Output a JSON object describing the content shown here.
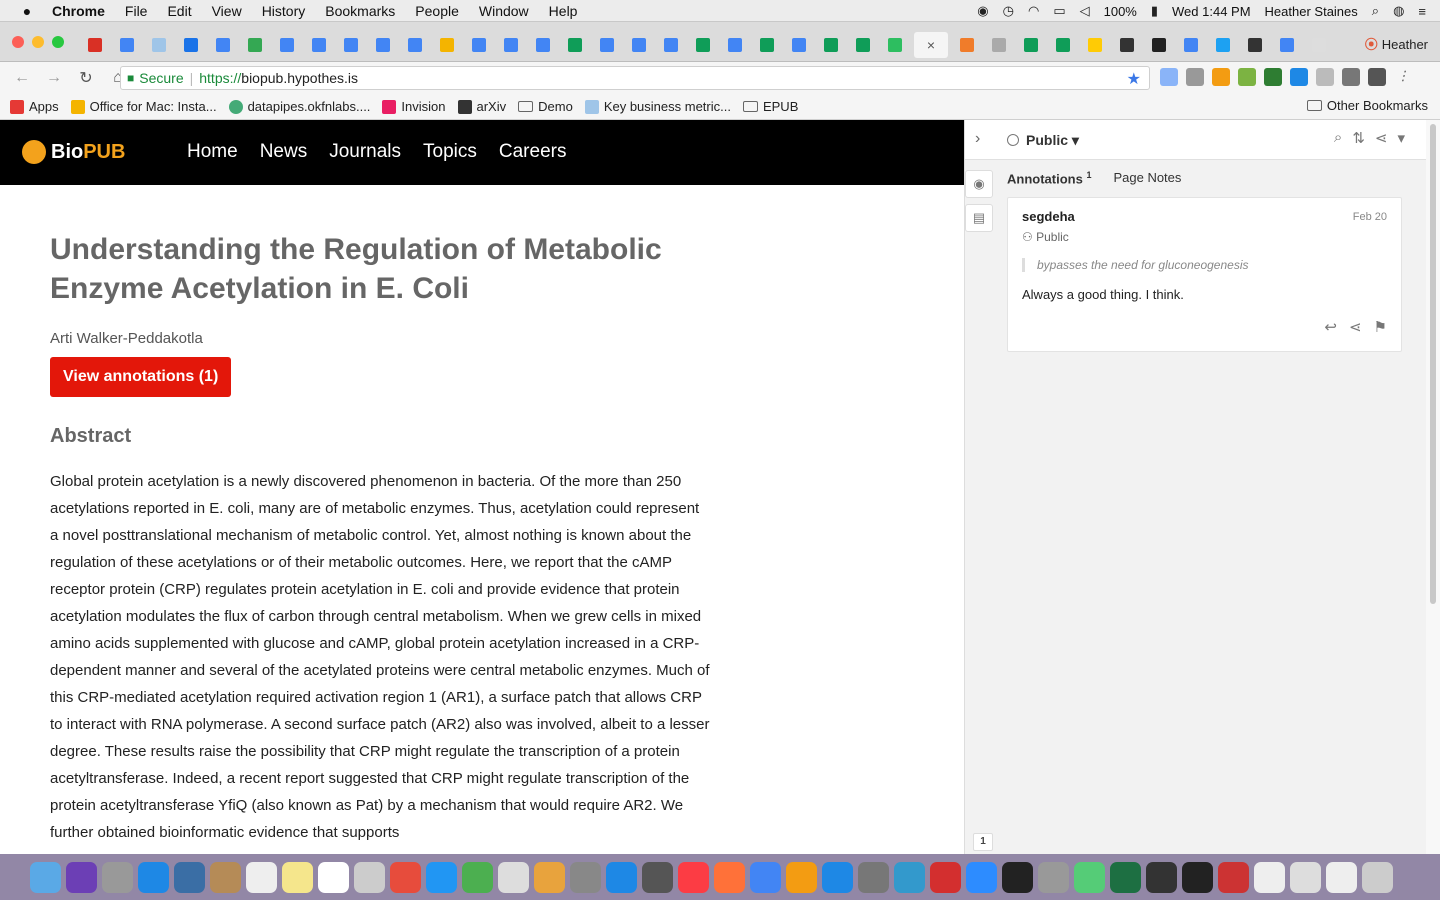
{
  "menubar": {
    "app": "Chrome",
    "items": [
      "File",
      "Edit",
      "View",
      "History",
      "Bookmarks",
      "People",
      "Window",
      "Help"
    ],
    "battery": "100%",
    "clock": "Wed 1:44 PM",
    "user": "Heather Staines"
  },
  "tabstrip": {
    "profile_name": "Heather",
    "close_glyph": "×",
    "tab_icons": [
      "gmail",
      "docs",
      "photos",
      "calendar",
      "docs",
      "drive",
      "docs",
      "docs",
      "docs",
      "docs",
      "docs",
      "slides",
      "docs",
      "docs",
      "docs",
      "sheets",
      "docs",
      "docs",
      "docs",
      "sheets",
      "docs",
      "sheets",
      "docs",
      "sheets",
      "sheets",
      "evernote",
      "active",
      "w3schools",
      "file",
      "sheets",
      "sheets",
      "michigan",
      "hypothesis",
      "hypothesis-h",
      "docs",
      "twitter",
      "hypothesis",
      "docs",
      "new-tab"
    ]
  },
  "addressbar": {
    "secure_label": "Secure",
    "url_scheme": "https://",
    "url_host": "biopub.hypothes.is"
  },
  "bookmarks": {
    "items": [
      "Apps",
      "Office for Mac: Insta...",
      "datapipes.okfnlabs....",
      "Invision",
      "arXiv",
      "Demo",
      "Key business metric...",
      "EPUB"
    ],
    "other": "Other Bookmarks"
  },
  "site": {
    "logo_bio": "Bio",
    "logo_pub": "PUB",
    "nav": [
      "Home",
      "News",
      "Journals",
      "Topics",
      "Careers"
    ]
  },
  "article": {
    "title": "Understanding the Regulation of Metabolic Enzyme Acetylation in E. Coli",
    "author": "Arti Walker-Peddakotla",
    "view_button": "View annotations (1)",
    "abstract_heading": "Abstract",
    "abstract_text": "Global protein acetylation is a newly discovered phenomenon in bacteria. Of the more than 250 acetylations reported in E. coli, many are of metabolic enzymes. Thus, acetylation could represent a novel posttranslational mechanism of metabolic control. Yet, almost nothing is known about the regulation of these acetylations or of their metabolic outcomes. Here, we report that the cAMP receptor protein (CRP) regulates protein acetylation in E. coli and provide evidence that protein acetylation modulates the flux of carbon through central metabolism. When we grew cells in mixed amino acids supplemented with glucose and cAMP, global protein acetylation increased in a CRP-dependent manner and several of the acetylated proteins were central metabolic enzymes. Much of this CRP-mediated acetylation required activation region 1 (AR1), a surface patch that allows CRP to interact with RNA polymerase. A second surface patch (AR2) also was involved, albeit to a lesser degree. These results raise the possibility that CRP might regulate the transcription of a protein acetyltransferase. Indeed, a recent report suggested that CRP might regulate transcription of the protein acetyltransferase YfiQ (also known as Pat) by a mechanism that would require AR2. We further obtained bioinformatic evidence that supports"
  },
  "sidebar": {
    "scope": "Public",
    "tab_annotations": "Annotations",
    "annotations_count": "1",
    "tab_page_notes": "Page Notes",
    "annotation": {
      "user": "segdeha",
      "date": "Feb 20",
      "privacy": "Public",
      "quote": "bypasses the need for gluconeogenesis",
      "text": "Always a good thing. I think."
    },
    "bucket_count": "1"
  },
  "colors": {
    "biopub_accent": "#f3a21c",
    "button_red": "#e3170a",
    "secure_green": "#1a8a3a"
  }
}
